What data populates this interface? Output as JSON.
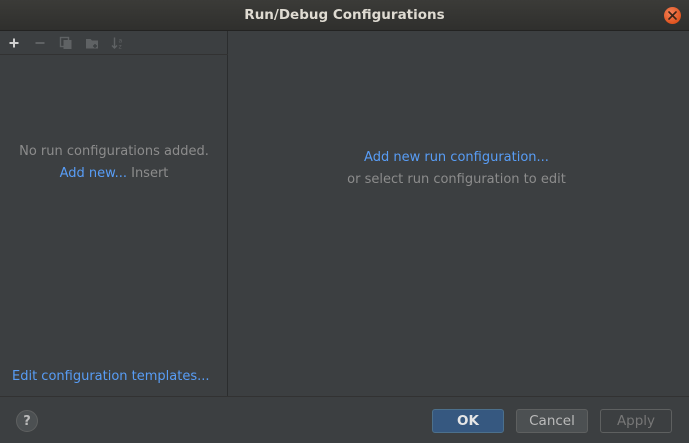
{
  "window": {
    "title": "Run/Debug Configurations",
    "close_icon": "close-icon"
  },
  "toolbar": {
    "icons": [
      "add-icon",
      "remove-icon",
      "copy-icon",
      "folder-icon",
      "sort-icon"
    ]
  },
  "left_panel": {
    "empty_message": "No run configurations added.",
    "add_new_link": "Add new...",
    "add_new_shortcut": "Insert",
    "templates_link": "Edit configuration templates..."
  },
  "right_panel": {
    "add_config_link": "Add new run configuration...",
    "select_hint": "or select run configuration to edit"
  },
  "buttons": {
    "help_label": "?",
    "ok_label": "OK",
    "cancel_label": "Cancel",
    "apply_label": "Apply"
  },
  "colors": {
    "background": "#3c3f41",
    "link": "#589df6",
    "ok_button": "#365880",
    "close_button": "#e0541f"
  }
}
